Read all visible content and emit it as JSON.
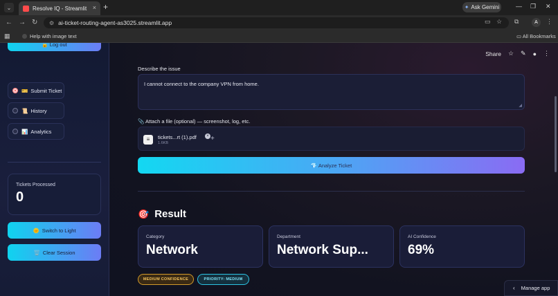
{
  "browser": {
    "tab_title": "Resolve IQ - Streamlit",
    "tab_close": "×",
    "new_tab": "+",
    "ask_gemini": "Ask Gemini",
    "url": "ai-ticket-routing-agent-as3025.streamlit.app",
    "profile_initial": "A",
    "bookmark_item": "Help with image text",
    "all_bookmarks": "All Bookmarks"
  },
  "sidebar": {
    "logout_label": "🔓 Log out",
    "nav": [
      {
        "emoji": "🎫",
        "label": "Submit Ticket",
        "selected": true
      },
      {
        "emoji": "📜",
        "label": "History",
        "selected": false
      },
      {
        "emoji": "📊",
        "label": "Analytics",
        "selected": false
      }
    ],
    "metric": {
      "label": "Tickets Processed",
      "value": "0"
    },
    "switch_theme": {
      "emoji": "🌞",
      "label": "Switch to Light"
    },
    "clear_session": {
      "emoji": "🗑️",
      "label": "Clear Session"
    }
  },
  "header": {
    "share": "Share"
  },
  "form": {
    "issue_label": "Describe the issue",
    "issue_value": "I cannot connect to the company VPN from home.",
    "attach_label": "📎 Attach a file (optional) — screenshot, log, etc.",
    "file_name": "tickets...rt (1).pdf",
    "file_size": "1.6KB",
    "analyze_label": "💎 Analyze Ticket",
    "analyze_emoji": "💎"
  },
  "result": {
    "title": "Result",
    "title_emoji": "🎯",
    "cards": [
      {
        "label": "Category",
        "value": "Network"
      },
      {
        "label": "Department",
        "value": "Network Sup..."
      },
      {
        "label": "AI Confidence",
        "value": "69%"
      }
    ],
    "badges": {
      "confidence": "MEDIUM CONFIDENCE",
      "priority": "PRIORITY: MEDIUM"
    }
  },
  "footer": {
    "manage_app": "Manage app"
  },
  "colors": {
    "accent_cyan": "#0fd3ef",
    "accent_purple": "#8a6bf3",
    "radio_selected": "#ff4b4b",
    "badge_medium": "#d29a2a",
    "badge_priority": "#2cc3e3"
  }
}
